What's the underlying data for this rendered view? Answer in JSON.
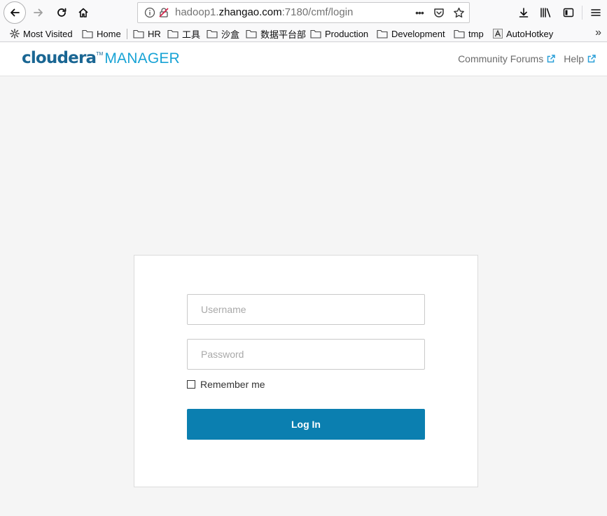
{
  "browser": {
    "url": {
      "prefix": "hadoop1.",
      "host": "zhangao.com",
      "suffix": ":7180/cmf/login"
    },
    "page_actions_glyph": "•••"
  },
  "bookmarks": [
    {
      "label": "Most Visited",
      "icon": "gear-icon"
    },
    {
      "label": "Home",
      "icon": "folder-icon"
    },
    {
      "label": "HR",
      "icon": "folder-icon"
    },
    {
      "label": "工具",
      "icon": "folder-icon"
    },
    {
      "label": "沙盒",
      "icon": "folder-icon"
    },
    {
      "label": "数据平台部",
      "icon": "folder-icon"
    },
    {
      "label": "Production",
      "icon": "folder-icon"
    },
    {
      "label": "Development",
      "icon": "folder-icon"
    },
    {
      "label": "tmp",
      "icon": "folder-icon"
    },
    {
      "label": "AutoHotkey",
      "icon": "autohotkey-icon"
    }
  ],
  "bookmarks_overflow": "»",
  "header": {
    "logo_word": "cloudera",
    "logo_tm": "TM",
    "logo_product": "MANAGER",
    "links": [
      {
        "label": "Community Forums"
      },
      {
        "label": "Help"
      }
    ]
  },
  "login": {
    "username_placeholder": "Username",
    "password_placeholder": "Password",
    "remember_label": "Remember me",
    "button_label": "Log In"
  },
  "colors": {
    "brand_dark": "#1a6693",
    "brand_light": "#18a3d5",
    "button": "#0b7fb0",
    "page_bg": "#f5f5f5"
  }
}
